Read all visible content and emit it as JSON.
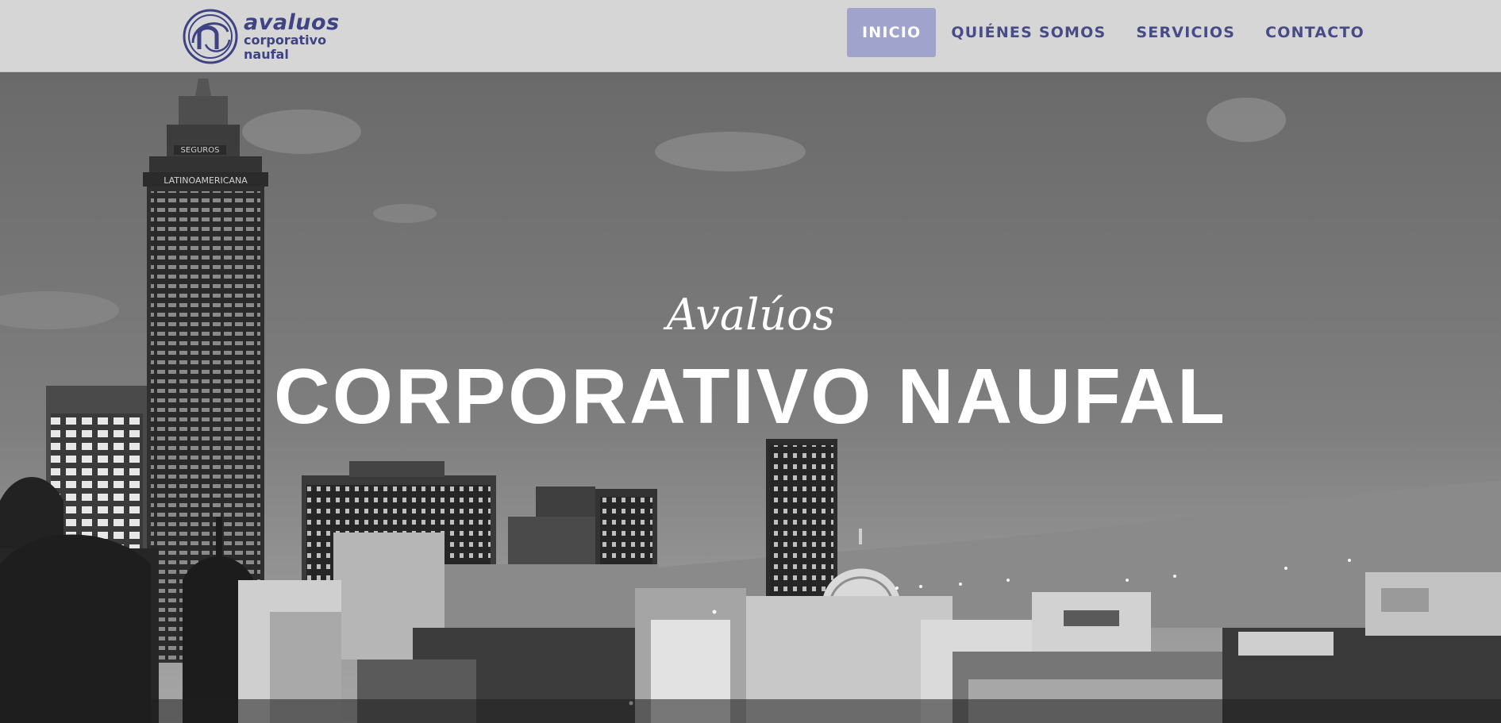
{
  "brand": {
    "logo_line1": "avaluos",
    "logo_line2": "corporativo",
    "logo_line3": "naufal",
    "logo_icon": "circular-n-emblem-icon",
    "color": "#3d4383"
  },
  "nav": {
    "items": [
      {
        "label": "INICIO",
        "active": true
      },
      {
        "label": "QUIÉNES SOMOS",
        "active": false
      },
      {
        "label": "SERVICIOS",
        "active": false
      },
      {
        "label": "CONTACTO",
        "active": false
      }
    ],
    "active_bg": "#a0a3cc",
    "text_color": "#474c86"
  },
  "hero": {
    "subtitle": "Avalúos",
    "title": "CORPORATIVO NAUFAL",
    "image": "grayscale-city-skyline",
    "tower_signs": {
      "top": "SEGUROS",
      "band": "LATINOAMERICANA"
    }
  }
}
